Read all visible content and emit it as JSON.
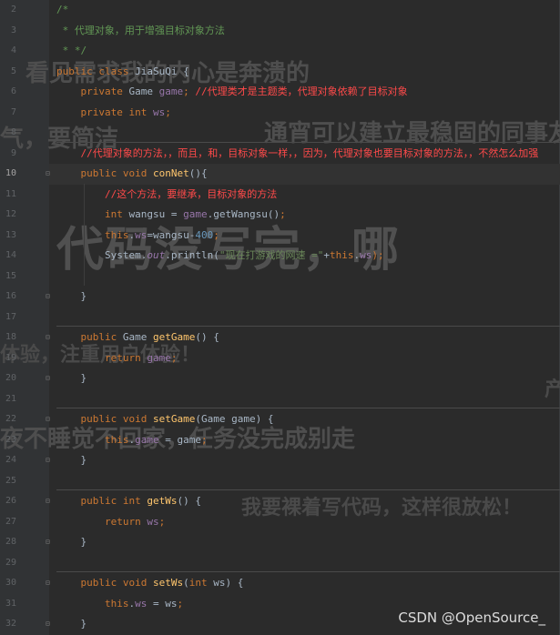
{
  "watermarks": [
    "看见需求我的内心是奔溃的",
    "通宵可以建立最稳固的同事友",
    "气，要简洁",
    "代码没写完，哪",
    "体验，注重用户体验！",
    "产",
    "夜不睡觉不回家，任务没完成别走",
    "我要裸着写代码，这样很放松！"
  ],
  "footer_brand": "CSDN @OpenSource_",
  "current_line": "10",
  "lines": [
    {
      "n": "2",
      "tokens": [
        {
          "t": "/*",
          "c": "doc"
        }
      ]
    },
    {
      "n": "3",
      "tokens": [
        {
          "t": " * 代理对象，用于增强目标对象方法",
          "c": "doc"
        }
      ]
    },
    {
      "n": "4",
      "tokens": [
        {
          "t": " * */",
          "c": "doc"
        }
      ]
    },
    {
      "n": "5",
      "tokens": [
        {
          "t": "public ",
          "c": "kw"
        },
        {
          "t": "class ",
          "c": "kw"
        },
        {
          "t": "JiaSuQi ",
          "c": "cls"
        },
        {
          "t": "{",
          "c": "cls"
        }
      ]
    },
    {
      "n": "6",
      "tokens": [
        {
          "t": "    private ",
          "c": "kw"
        },
        {
          "t": "Game ",
          "c": "cls"
        },
        {
          "t": "game",
          "c": "fld"
        },
        {
          "t": "; ",
          "c": "kw"
        },
        {
          "t": "//代理类才是主题类，代理对象依赖了目标对象",
          "c": "cm"
        }
      ]
    },
    {
      "n": "7",
      "tokens": [
        {
          "t": "    private ",
          "c": "kw"
        },
        {
          "t": "int ",
          "c": "kw"
        },
        {
          "t": "ws",
          "c": "fld"
        },
        {
          "t": ";",
          "c": "kw"
        }
      ]
    },
    {
      "n": "8",
      "tokens": []
    },
    {
      "n": "9",
      "tokens": [
        {
          "t": "    //代理对象的方法，，而且，和，目标对象一样，，因为，代理对象也要目标对象的方法，，不然怎么加强",
          "c": "cm"
        }
      ]
    },
    {
      "n": "10",
      "tokens": [
        {
          "t": "    public ",
          "c": "kw"
        },
        {
          "t": "void ",
          "c": "kw"
        },
        {
          "t": "conNet",
          "c": "fn"
        },
        {
          "t": "(){",
          "c": "cls"
        }
      ]
    },
    {
      "n": "11",
      "tokens": [
        {
          "t": "        //这个方法，要继承，目标对象的方法",
          "c": "cm"
        }
      ]
    },
    {
      "n": "12",
      "tokens": [
        {
          "t": "        int ",
          "c": "kw"
        },
        {
          "t": "wangsu ",
          "c": "cls"
        },
        {
          "t": "= ",
          "c": "cls"
        },
        {
          "t": "game",
          "c": "fld"
        },
        {
          "t": ".getWangsu()",
          "c": "cls"
        },
        {
          "t": ";",
          "c": "kw"
        }
      ]
    },
    {
      "n": "13",
      "tokens": [
        {
          "t": "        this",
          "c": "kw"
        },
        {
          "t": ".",
          "c": "cls"
        },
        {
          "t": "ws",
          "c": "fld"
        },
        {
          "t": "=wangsu-",
          "c": "cls"
        },
        {
          "t": "400",
          "c": "num"
        },
        {
          "t": ";",
          "c": "kw"
        }
      ]
    },
    {
      "n": "14",
      "tokens": [
        {
          "t": "        System.",
          "c": "cls"
        },
        {
          "t": "out",
          "c": "it"
        },
        {
          "t": ".println(",
          "c": "cls"
        },
        {
          "t": "\"现在打游戏的网速 =\"",
          "c": "str"
        },
        {
          "t": "+",
          "c": "cls"
        },
        {
          "t": "this",
          "c": "kw"
        },
        {
          "t": ".",
          "c": "cls"
        },
        {
          "t": "ws",
          "c": "fld"
        },
        {
          "t": ");",
          "c": "kw"
        }
      ]
    },
    {
      "n": "15",
      "tokens": []
    },
    {
      "n": "16",
      "tokens": [
        {
          "t": "    }",
          "c": "cls"
        }
      ]
    },
    {
      "n": "17",
      "tokens": []
    },
    {
      "n": "18",
      "tokens": [
        {
          "t": "    public ",
          "c": "kw"
        },
        {
          "t": "Game ",
          "c": "cls"
        },
        {
          "t": "getGame",
          "c": "fn"
        },
        {
          "t": "() {",
          "c": "cls"
        }
      ]
    },
    {
      "n": "19",
      "tokens": [
        {
          "t": "        return ",
          "c": "kw"
        },
        {
          "t": "game",
          "c": "fld"
        },
        {
          "t": ";",
          "c": "kw"
        }
      ]
    },
    {
      "n": "20",
      "tokens": [
        {
          "t": "    }",
          "c": "cls"
        }
      ]
    },
    {
      "n": "21",
      "tokens": []
    },
    {
      "n": "22",
      "tokens": [
        {
          "t": "    public ",
          "c": "kw"
        },
        {
          "t": "void ",
          "c": "kw"
        },
        {
          "t": "setGame",
          "c": "fn"
        },
        {
          "t": "(Game game) {",
          "c": "cls"
        }
      ]
    },
    {
      "n": "23",
      "tokens": [
        {
          "t": "        this",
          "c": "kw"
        },
        {
          "t": ".",
          "c": "cls"
        },
        {
          "t": "game ",
          "c": "fld"
        },
        {
          "t": "= game",
          "c": "cls"
        },
        {
          "t": ";",
          "c": "kw"
        }
      ]
    },
    {
      "n": "24",
      "tokens": [
        {
          "t": "    }",
          "c": "cls"
        }
      ]
    },
    {
      "n": "25",
      "tokens": []
    },
    {
      "n": "26",
      "tokens": [
        {
          "t": "    public ",
          "c": "kw"
        },
        {
          "t": "int ",
          "c": "kw"
        },
        {
          "t": "getWs",
          "c": "fn"
        },
        {
          "t": "() {",
          "c": "cls"
        }
      ]
    },
    {
      "n": "27",
      "tokens": [
        {
          "t": "        return ",
          "c": "kw"
        },
        {
          "t": "ws",
          "c": "fld"
        },
        {
          "t": ";",
          "c": "kw"
        }
      ]
    },
    {
      "n": "28",
      "tokens": [
        {
          "t": "    }",
          "c": "cls"
        }
      ]
    },
    {
      "n": "29",
      "tokens": []
    },
    {
      "n": "30",
      "tokens": [
        {
          "t": "    public ",
          "c": "kw"
        },
        {
          "t": "void ",
          "c": "kw"
        },
        {
          "t": "setWs",
          "c": "fn"
        },
        {
          "t": "(",
          "c": "cls"
        },
        {
          "t": "int ",
          "c": "kw"
        },
        {
          "t": "ws) {",
          "c": "cls"
        }
      ]
    },
    {
      "n": "31",
      "tokens": [
        {
          "t": "        this",
          "c": "kw"
        },
        {
          "t": ".",
          "c": "cls"
        },
        {
          "t": "ws ",
          "c": "fld"
        },
        {
          "t": "= ws",
          "c": "cls"
        },
        {
          "t": ";",
          "c": "kw"
        }
      ]
    },
    {
      "n": "32",
      "tokens": [
        {
          "t": "    }",
          "c": "cls"
        }
      ]
    }
  ]
}
